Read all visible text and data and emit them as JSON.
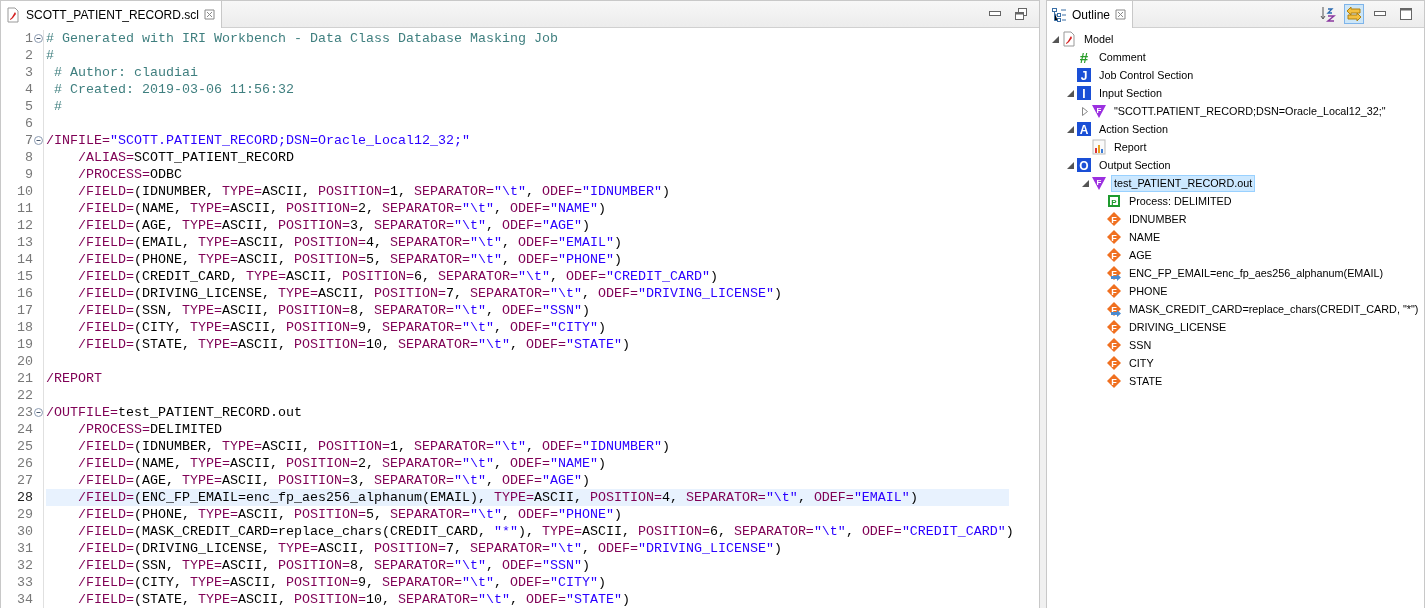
{
  "editor": {
    "tab": {
      "label": "SCOTT_PATIENT_RECORD.scl",
      "selected": true
    },
    "lines": [
      {
        "number": "1",
        "foldable": true,
        "current": false,
        "tokens": [
          {
            "kind": "comment",
            "text": "# Generated with IRI Workbench - Data Class Database Masking Job"
          }
        ]
      },
      {
        "number": "2",
        "foldable": false,
        "current": false,
        "tokens": [
          {
            "kind": "comment",
            "text": "#"
          }
        ]
      },
      {
        "number": "3",
        "foldable": false,
        "current": false,
        "tokens": [
          {
            "kind": "comment",
            "text": " # Author: claudiai"
          }
        ]
      },
      {
        "number": "4",
        "foldable": false,
        "current": false,
        "tokens": [
          {
            "kind": "comment",
            "text": " # Created: 2019-03-06 11:56:32"
          }
        ]
      },
      {
        "number": "5",
        "foldable": false,
        "current": false,
        "tokens": [
          {
            "kind": "comment",
            "text": " #"
          }
        ]
      },
      {
        "number": "6",
        "foldable": false,
        "current": false
      },
      {
        "number": "7",
        "foldable": true,
        "current": false,
        "tokens": [
          {
            "kind": "keyword",
            "text": "/INFILE="
          },
          {
            "kind": "string",
            "text": "\"SCOTT.PATIENT_RECORD;DSN=Oracle_Local12_32;\""
          }
        ]
      },
      {
        "number": "8",
        "foldable": false,
        "current": false,
        "tokens": [
          {
            "kind": "keyword",
            "text": "    /ALIAS="
          },
          {
            "kind": "plain",
            "text": "SCOTT_PATIENT_RECORD"
          }
        ]
      },
      {
        "number": "9",
        "foldable": false,
        "current": false,
        "tokens": [
          {
            "kind": "keyword",
            "text": "    /PROCESS="
          },
          {
            "kind": "plain",
            "text": "ODBC"
          }
        ]
      },
      {
        "number": "10",
        "foldable": false,
        "current": false,
        "tokens": [
          {
            "kind": "keyword",
            "text": "    /FIELD="
          },
          {
            "kind": "plain",
            "text": "(IDNUMBER, "
          },
          {
            "kind": "keyword",
            "text": "TYPE="
          },
          {
            "kind": "plain",
            "text": "ASCII, "
          },
          {
            "kind": "keyword",
            "text": "POSITION="
          },
          {
            "kind": "plain",
            "text": "1, "
          },
          {
            "kind": "keyword",
            "text": "SEPARATOR="
          },
          {
            "kind": "string",
            "text": "\"\\t\""
          },
          {
            "kind": "plain",
            "text": ", "
          },
          {
            "kind": "keyword",
            "text": "ODEF="
          },
          {
            "kind": "string",
            "text": "\"IDNUMBER\""
          },
          {
            "kind": "plain",
            "text": ")"
          }
        ]
      },
      {
        "number": "11",
        "foldable": false,
        "current": false,
        "tokens": [
          {
            "kind": "keyword",
            "text": "    /FIELD="
          },
          {
            "kind": "plain",
            "text": "(NAME, "
          },
          {
            "kind": "keyword",
            "text": "TYPE="
          },
          {
            "kind": "plain",
            "text": "ASCII, "
          },
          {
            "kind": "keyword",
            "text": "POSITION="
          },
          {
            "kind": "plain",
            "text": "2, "
          },
          {
            "kind": "keyword",
            "text": "SEPARATOR="
          },
          {
            "kind": "string",
            "text": "\"\\t\""
          },
          {
            "kind": "plain",
            "text": ", "
          },
          {
            "kind": "keyword",
            "text": "ODEF="
          },
          {
            "kind": "string",
            "text": "\"NAME\""
          },
          {
            "kind": "plain",
            "text": ")"
          }
        ]
      },
      {
        "number": "12",
        "foldable": false,
        "current": false,
        "tokens": [
          {
            "kind": "keyword",
            "text": "    /FIELD="
          },
          {
            "kind": "plain",
            "text": "(AGE, "
          },
          {
            "kind": "keyword",
            "text": "TYPE="
          },
          {
            "kind": "plain",
            "text": "ASCII, "
          },
          {
            "kind": "keyword",
            "text": "POSITION="
          },
          {
            "kind": "plain",
            "text": "3, "
          },
          {
            "kind": "keyword",
            "text": "SEPARATOR="
          },
          {
            "kind": "string",
            "text": "\"\\t\""
          },
          {
            "kind": "plain",
            "text": ", "
          },
          {
            "kind": "keyword",
            "text": "ODEF="
          },
          {
            "kind": "string",
            "text": "\"AGE\""
          },
          {
            "kind": "plain",
            "text": ")"
          }
        ]
      },
      {
        "number": "13",
        "foldable": false,
        "current": false,
        "tokens": [
          {
            "kind": "keyword",
            "text": "    /FIELD="
          },
          {
            "kind": "plain",
            "text": "(EMAIL, "
          },
          {
            "kind": "keyword",
            "text": "TYPE="
          },
          {
            "kind": "plain",
            "text": "ASCII, "
          },
          {
            "kind": "keyword",
            "text": "POSITION="
          },
          {
            "kind": "plain",
            "text": "4, "
          },
          {
            "kind": "keyword",
            "text": "SEPARATOR="
          },
          {
            "kind": "string",
            "text": "\"\\t\""
          },
          {
            "kind": "plain",
            "text": ", "
          },
          {
            "kind": "keyword",
            "text": "ODEF="
          },
          {
            "kind": "string",
            "text": "\"EMAIL\""
          },
          {
            "kind": "plain",
            "text": ")"
          }
        ]
      },
      {
        "number": "14",
        "foldable": false,
        "current": false,
        "tokens": [
          {
            "kind": "keyword",
            "text": "    /FIELD="
          },
          {
            "kind": "plain",
            "text": "(PHONE, "
          },
          {
            "kind": "keyword",
            "text": "TYPE="
          },
          {
            "kind": "plain",
            "text": "ASCII, "
          },
          {
            "kind": "keyword",
            "text": "POSITION="
          },
          {
            "kind": "plain",
            "text": "5, "
          },
          {
            "kind": "keyword",
            "text": "SEPARATOR="
          },
          {
            "kind": "string",
            "text": "\"\\t\""
          },
          {
            "kind": "plain",
            "text": ", "
          },
          {
            "kind": "keyword",
            "text": "ODEF="
          },
          {
            "kind": "string",
            "text": "\"PHONE\""
          },
          {
            "kind": "plain",
            "text": ")"
          }
        ]
      },
      {
        "number": "15",
        "foldable": false,
        "current": false,
        "tokens": [
          {
            "kind": "keyword",
            "text": "    /FIELD="
          },
          {
            "kind": "plain",
            "text": "(CREDIT_CARD, "
          },
          {
            "kind": "keyword",
            "text": "TYPE="
          },
          {
            "kind": "plain",
            "text": "ASCII, "
          },
          {
            "kind": "keyword",
            "text": "POSITION="
          },
          {
            "kind": "plain",
            "text": "6, "
          },
          {
            "kind": "keyword",
            "text": "SEPARATOR="
          },
          {
            "kind": "string",
            "text": "\"\\t\""
          },
          {
            "kind": "plain",
            "text": ", "
          },
          {
            "kind": "keyword",
            "text": "ODEF="
          },
          {
            "kind": "string",
            "text": "\"CREDIT_CARD\""
          },
          {
            "kind": "plain",
            "text": ")"
          }
        ]
      },
      {
        "number": "16",
        "foldable": false,
        "current": false,
        "tokens": [
          {
            "kind": "keyword",
            "text": "    /FIELD="
          },
          {
            "kind": "plain",
            "text": "(DRIVING_LICENSE, "
          },
          {
            "kind": "keyword",
            "text": "TYPE="
          },
          {
            "kind": "plain",
            "text": "ASCII, "
          },
          {
            "kind": "keyword",
            "text": "POSITION="
          },
          {
            "kind": "plain",
            "text": "7, "
          },
          {
            "kind": "keyword",
            "text": "SEPARATOR="
          },
          {
            "kind": "string",
            "text": "\"\\t\""
          },
          {
            "kind": "plain",
            "text": ", "
          },
          {
            "kind": "keyword",
            "text": "ODEF="
          },
          {
            "kind": "string",
            "text": "\"DRIVING_LICENSE\""
          },
          {
            "kind": "plain",
            "text": ")"
          }
        ]
      },
      {
        "number": "17",
        "foldable": false,
        "current": false,
        "tokens": [
          {
            "kind": "keyword",
            "text": "    /FIELD="
          },
          {
            "kind": "plain",
            "text": "(SSN, "
          },
          {
            "kind": "keyword",
            "text": "TYPE="
          },
          {
            "kind": "plain",
            "text": "ASCII, "
          },
          {
            "kind": "keyword",
            "text": "POSITION="
          },
          {
            "kind": "plain",
            "text": "8, "
          },
          {
            "kind": "keyword",
            "text": "SEPARATOR="
          },
          {
            "kind": "string",
            "text": "\"\\t\""
          },
          {
            "kind": "plain",
            "text": ", "
          },
          {
            "kind": "keyword",
            "text": "ODEF="
          },
          {
            "kind": "string",
            "text": "\"SSN\""
          },
          {
            "kind": "plain",
            "text": ")"
          }
        ]
      },
      {
        "number": "18",
        "foldable": false,
        "current": false,
        "tokens": [
          {
            "kind": "keyword",
            "text": "    /FIELD="
          },
          {
            "kind": "plain",
            "text": "(CITY, "
          },
          {
            "kind": "keyword",
            "text": "TYPE="
          },
          {
            "kind": "plain",
            "text": "ASCII, "
          },
          {
            "kind": "keyword",
            "text": "POSITION="
          },
          {
            "kind": "plain",
            "text": "9, "
          },
          {
            "kind": "keyword",
            "text": "SEPARATOR="
          },
          {
            "kind": "string",
            "text": "\"\\t\""
          },
          {
            "kind": "plain",
            "text": ", "
          },
          {
            "kind": "keyword",
            "text": "ODEF="
          },
          {
            "kind": "string",
            "text": "\"CITY\""
          },
          {
            "kind": "plain",
            "text": ")"
          }
        ]
      },
      {
        "number": "19",
        "foldable": false,
        "current": false,
        "tokens": [
          {
            "kind": "keyword",
            "text": "    /FIELD="
          },
          {
            "kind": "plain",
            "text": "(STATE, "
          },
          {
            "kind": "keyword",
            "text": "TYPE="
          },
          {
            "kind": "plain",
            "text": "ASCII, "
          },
          {
            "kind": "keyword",
            "text": "POSITION="
          },
          {
            "kind": "plain",
            "text": "10, "
          },
          {
            "kind": "keyword",
            "text": "SEPARATOR="
          },
          {
            "kind": "string",
            "text": "\"\\t\""
          },
          {
            "kind": "plain",
            "text": ", "
          },
          {
            "kind": "keyword",
            "text": "ODEF="
          },
          {
            "kind": "string",
            "text": "\"STATE\""
          },
          {
            "kind": "plain",
            "text": ")"
          }
        ]
      },
      {
        "number": "20",
        "foldable": false,
        "current": false
      },
      {
        "number": "21",
        "foldable": false,
        "current": false,
        "tokens": [
          {
            "kind": "keyword",
            "text": "/REPORT"
          }
        ]
      },
      {
        "number": "22",
        "foldable": false,
        "current": false
      },
      {
        "number": "23",
        "foldable": true,
        "current": false,
        "tokens": [
          {
            "kind": "keyword",
            "text": "/OUTFILE="
          },
          {
            "kind": "plain",
            "text": "test_PATIENT_RECORD.out"
          }
        ]
      },
      {
        "number": "24",
        "foldable": false,
        "current": false,
        "tokens": [
          {
            "kind": "keyword",
            "text": "    /PROCESS="
          },
          {
            "kind": "plain",
            "text": "DELIMITED"
          }
        ]
      },
      {
        "number": "25",
        "foldable": false,
        "current": false,
        "tokens": [
          {
            "kind": "keyword",
            "text": "    /FIELD="
          },
          {
            "kind": "plain",
            "text": "(IDNUMBER, "
          },
          {
            "kind": "keyword",
            "text": "TYPE="
          },
          {
            "kind": "plain",
            "text": "ASCII, "
          },
          {
            "kind": "keyword",
            "text": "POSITION="
          },
          {
            "kind": "plain",
            "text": "1, "
          },
          {
            "kind": "keyword",
            "text": "SEPARATOR="
          },
          {
            "kind": "string",
            "text": "\"\\t\""
          },
          {
            "kind": "plain",
            "text": ", "
          },
          {
            "kind": "keyword",
            "text": "ODEF="
          },
          {
            "kind": "string",
            "text": "\"IDNUMBER\""
          },
          {
            "kind": "plain",
            "text": ")"
          }
        ]
      },
      {
        "number": "26",
        "foldable": false,
        "current": false,
        "tokens": [
          {
            "kind": "keyword",
            "text": "    /FIELD="
          },
          {
            "kind": "plain",
            "text": "(NAME, "
          },
          {
            "kind": "keyword",
            "text": "TYPE="
          },
          {
            "kind": "plain",
            "text": "ASCII, "
          },
          {
            "kind": "keyword",
            "text": "POSITION="
          },
          {
            "kind": "plain",
            "text": "2, "
          },
          {
            "kind": "keyword",
            "text": "SEPARATOR="
          },
          {
            "kind": "string",
            "text": "\"\\t\""
          },
          {
            "kind": "plain",
            "text": ", "
          },
          {
            "kind": "keyword",
            "text": "ODEF="
          },
          {
            "kind": "string",
            "text": "\"NAME\""
          },
          {
            "kind": "plain",
            "text": ")"
          }
        ]
      },
      {
        "number": "27",
        "foldable": false,
        "current": false,
        "tokens": [
          {
            "kind": "keyword",
            "text": "    /FIELD="
          },
          {
            "kind": "plain",
            "text": "(AGE, "
          },
          {
            "kind": "keyword",
            "text": "TYPE="
          },
          {
            "kind": "plain",
            "text": "ASCII, "
          },
          {
            "kind": "keyword",
            "text": "POSITION="
          },
          {
            "kind": "plain",
            "text": "3, "
          },
          {
            "kind": "keyword",
            "text": "SEPARATOR="
          },
          {
            "kind": "string",
            "text": "\"\\t\""
          },
          {
            "kind": "plain",
            "text": ", "
          },
          {
            "kind": "keyword",
            "text": "ODEF="
          },
          {
            "kind": "string",
            "text": "\"AGE\""
          },
          {
            "kind": "plain",
            "text": ")"
          }
        ]
      },
      {
        "number": "28",
        "foldable": false,
        "current": true,
        "tokens": [
          {
            "kind": "keyword",
            "text": "    /FIELD="
          },
          {
            "kind": "plain",
            "text": "(ENC_FP_EMAIL=enc_fp_aes256_alphanum(EMAIL), "
          },
          {
            "kind": "keyword",
            "text": "TYPE="
          },
          {
            "kind": "plain",
            "text": "ASCII, "
          },
          {
            "kind": "keyword",
            "text": "POSITION="
          },
          {
            "kind": "plain",
            "text": "4, "
          },
          {
            "kind": "keyword",
            "text": "SEPARATOR="
          },
          {
            "kind": "string",
            "text": "\"\\t\""
          },
          {
            "kind": "plain",
            "text": ", "
          },
          {
            "kind": "keyword",
            "text": "ODEF="
          },
          {
            "kind": "string",
            "text": "\"EMAIL\""
          },
          {
            "kind": "plain",
            "text": ")"
          }
        ]
      },
      {
        "number": "29",
        "foldable": false,
        "current": false,
        "tokens": [
          {
            "kind": "keyword",
            "text": "    /FIELD="
          },
          {
            "kind": "plain",
            "text": "(PHONE, "
          },
          {
            "kind": "keyword",
            "text": "TYPE="
          },
          {
            "kind": "plain",
            "text": "ASCII, "
          },
          {
            "kind": "keyword",
            "text": "POSITION="
          },
          {
            "kind": "plain",
            "text": "5, "
          },
          {
            "kind": "keyword",
            "text": "SEPARATOR="
          },
          {
            "kind": "string",
            "text": "\"\\t\""
          },
          {
            "kind": "plain",
            "text": ", "
          },
          {
            "kind": "keyword",
            "text": "ODEF="
          },
          {
            "kind": "string",
            "text": "\"PHONE\""
          },
          {
            "kind": "plain",
            "text": ")"
          }
        ]
      },
      {
        "number": "30",
        "foldable": false,
        "current": false,
        "tokens": [
          {
            "kind": "keyword",
            "text": "    /FIELD="
          },
          {
            "kind": "plain",
            "text": "(MASK_CREDIT_CARD=replace_chars(CREDIT_CARD, "
          },
          {
            "kind": "string",
            "text": "\"*\""
          },
          {
            "kind": "plain",
            "text": "), "
          },
          {
            "kind": "keyword",
            "text": "TYPE="
          },
          {
            "kind": "plain",
            "text": "ASCII, "
          },
          {
            "kind": "keyword",
            "text": "POSITION="
          },
          {
            "kind": "plain",
            "text": "6, "
          },
          {
            "kind": "keyword",
            "text": "SEPARATOR="
          },
          {
            "kind": "string",
            "text": "\"\\t\""
          },
          {
            "kind": "plain",
            "text": ", "
          },
          {
            "kind": "keyword",
            "text": "ODEF="
          },
          {
            "kind": "string",
            "text": "\"CREDIT_CARD\""
          },
          {
            "kind": "plain",
            "text": ")"
          }
        ]
      },
      {
        "number": "31",
        "foldable": false,
        "current": false,
        "tokens": [
          {
            "kind": "keyword",
            "text": "    /FIELD="
          },
          {
            "kind": "plain",
            "text": "(DRIVING_LICENSE, "
          },
          {
            "kind": "keyword",
            "text": "TYPE="
          },
          {
            "kind": "plain",
            "text": "ASCII, "
          },
          {
            "kind": "keyword",
            "text": "POSITION="
          },
          {
            "kind": "plain",
            "text": "7, "
          },
          {
            "kind": "keyword",
            "text": "SEPARATOR="
          },
          {
            "kind": "string",
            "text": "\"\\t\""
          },
          {
            "kind": "plain",
            "text": ", "
          },
          {
            "kind": "keyword",
            "text": "ODEF="
          },
          {
            "kind": "string",
            "text": "\"DRIVING_LICENSE\""
          },
          {
            "kind": "plain",
            "text": ")"
          }
        ]
      },
      {
        "number": "32",
        "foldable": false,
        "current": false,
        "tokens": [
          {
            "kind": "keyword",
            "text": "    /FIELD="
          },
          {
            "kind": "plain",
            "text": "(SSN, "
          },
          {
            "kind": "keyword",
            "text": "TYPE="
          },
          {
            "kind": "plain",
            "text": "ASCII, "
          },
          {
            "kind": "keyword",
            "text": "POSITION="
          },
          {
            "kind": "plain",
            "text": "8, "
          },
          {
            "kind": "keyword",
            "text": "SEPARATOR="
          },
          {
            "kind": "string",
            "text": "\"\\t\""
          },
          {
            "kind": "plain",
            "text": ", "
          },
          {
            "kind": "keyword",
            "text": "ODEF="
          },
          {
            "kind": "string",
            "text": "\"SSN\""
          },
          {
            "kind": "plain",
            "text": ")"
          }
        ]
      },
      {
        "number": "33",
        "foldable": false,
        "current": false,
        "tokens": [
          {
            "kind": "keyword",
            "text": "    /FIELD="
          },
          {
            "kind": "plain",
            "text": "(CITY, "
          },
          {
            "kind": "keyword",
            "text": "TYPE="
          },
          {
            "kind": "plain",
            "text": "ASCII, "
          },
          {
            "kind": "keyword",
            "text": "POSITION="
          },
          {
            "kind": "plain",
            "text": "9, "
          },
          {
            "kind": "keyword",
            "text": "SEPARATOR="
          },
          {
            "kind": "string",
            "text": "\"\\t\""
          },
          {
            "kind": "plain",
            "text": ", "
          },
          {
            "kind": "keyword",
            "text": "ODEF="
          },
          {
            "kind": "string",
            "text": "\"CITY\""
          },
          {
            "kind": "plain",
            "text": ")"
          }
        ]
      },
      {
        "number": "34",
        "foldable": false,
        "current": false,
        "tokens": [
          {
            "kind": "keyword",
            "text": "    /FIELD="
          },
          {
            "kind": "plain",
            "text": "(STATE, "
          },
          {
            "kind": "keyword",
            "text": "TYPE="
          },
          {
            "kind": "plain",
            "text": "ASCII, "
          },
          {
            "kind": "keyword",
            "text": "POSITION="
          },
          {
            "kind": "plain",
            "text": "10, "
          },
          {
            "kind": "keyword",
            "text": "SEPARATOR="
          },
          {
            "kind": "string",
            "text": "\"\\t\""
          },
          {
            "kind": "plain",
            "text": ", "
          },
          {
            "kind": "keyword",
            "text": "ODEF="
          },
          {
            "kind": "string",
            "text": "\"STATE\""
          },
          {
            "kind": "plain",
            "text": ")"
          }
        ]
      }
    ]
  },
  "outline": {
    "tab": {
      "label": "Outline",
      "selected": true
    },
    "link_with_editor": {
      "pressed": true
    },
    "items": [
      {
        "label": "Model",
        "kind": "model",
        "expanded": true,
        "selected": false,
        "children": [
          {
            "label": "Comment",
            "kind": "comment",
            "badge": "#",
            "selected": false
          },
          {
            "label": "Job Control Section",
            "kind": "section",
            "badge": "J",
            "selected": false
          },
          {
            "label": "Input Section",
            "kind": "section",
            "badge": "I",
            "expanded": true,
            "selected": false,
            "children": [
              {
                "label": "\"SCOTT.PATIENT_RECORD;DSN=Oracle_Local12_32;\"",
                "kind": "dataset",
                "badge": "F",
                "expanded": false,
                "selected": false
              }
            ]
          },
          {
            "label": "Action Section",
            "kind": "section",
            "badge": "A",
            "expanded": true,
            "selected": false,
            "children": [
              {
                "label": "Report",
                "kind": "report",
                "selected": false
              }
            ]
          },
          {
            "label": "Output Section",
            "kind": "section",
            "badge": "O",
            "expanded": true,
            "selected": false,
            "children": [
              {
                "label": "test_PATIENT_RECORD.out",
                "kind": "dataset",
                "badge": "F",
                "expanded": true,
                "selected": true,
                "children": [
                  {
                    "label": "Process: DELIMITED",
                    "kind": "process",
                    "badge": "P",
                    "selected": false
                  },
                  {
                    "label": "IDNUMBER",
                    "kind": "field",
                    "badge": "F",
                    "selected": false
                  },
                  {
                    "label": "NAME",
                    "kind": "field",
                    "badge": "F",
                    "selected": false
                  },
                  {
                    "label": "AGE",
                    "kind": "field",
                    "badge": "F",
                    "selected": false
                  },
                  {
                    "label": "ENC_FP_EMAIL=enc_fp_aes256_alphanum(EMAIL)",
                    "kind": "derived",
                    "badge": "F",
                    "selected": false
                  },
                  {
                    "label": "PHONE",
                    "kind": "field",
                    "badge": "F",
                    "selected": false
                  },
                  {
                    "label": "MASK_CREDIT_CARD=replace_chars(CREDIT_CARD, \"*\")",
                    "kind": "derived",
                    "badge": "F",
                    "selected": false
                  },
                  {
                    "label": "DRIVING_LICENSE",
                    "kind": "field",
                    "badge": "F",
                    "selected": false
                  },
                  {
                    "label": "SSN",
                    "kind": "field",
                    "badge": "F",
                    "selected": false
                  },
                  {
                    "label": "CITY",
                    "kind": "field",
                    "badge": "F",
                    "selected": false
                  },
                  {
                    "label": "STATE",
                    "kind": "field",
                    "badge": "F",
                    "selected": false
                  }
                ]
              }
            ]
          }
        ]
      }
    ]
  }
}
